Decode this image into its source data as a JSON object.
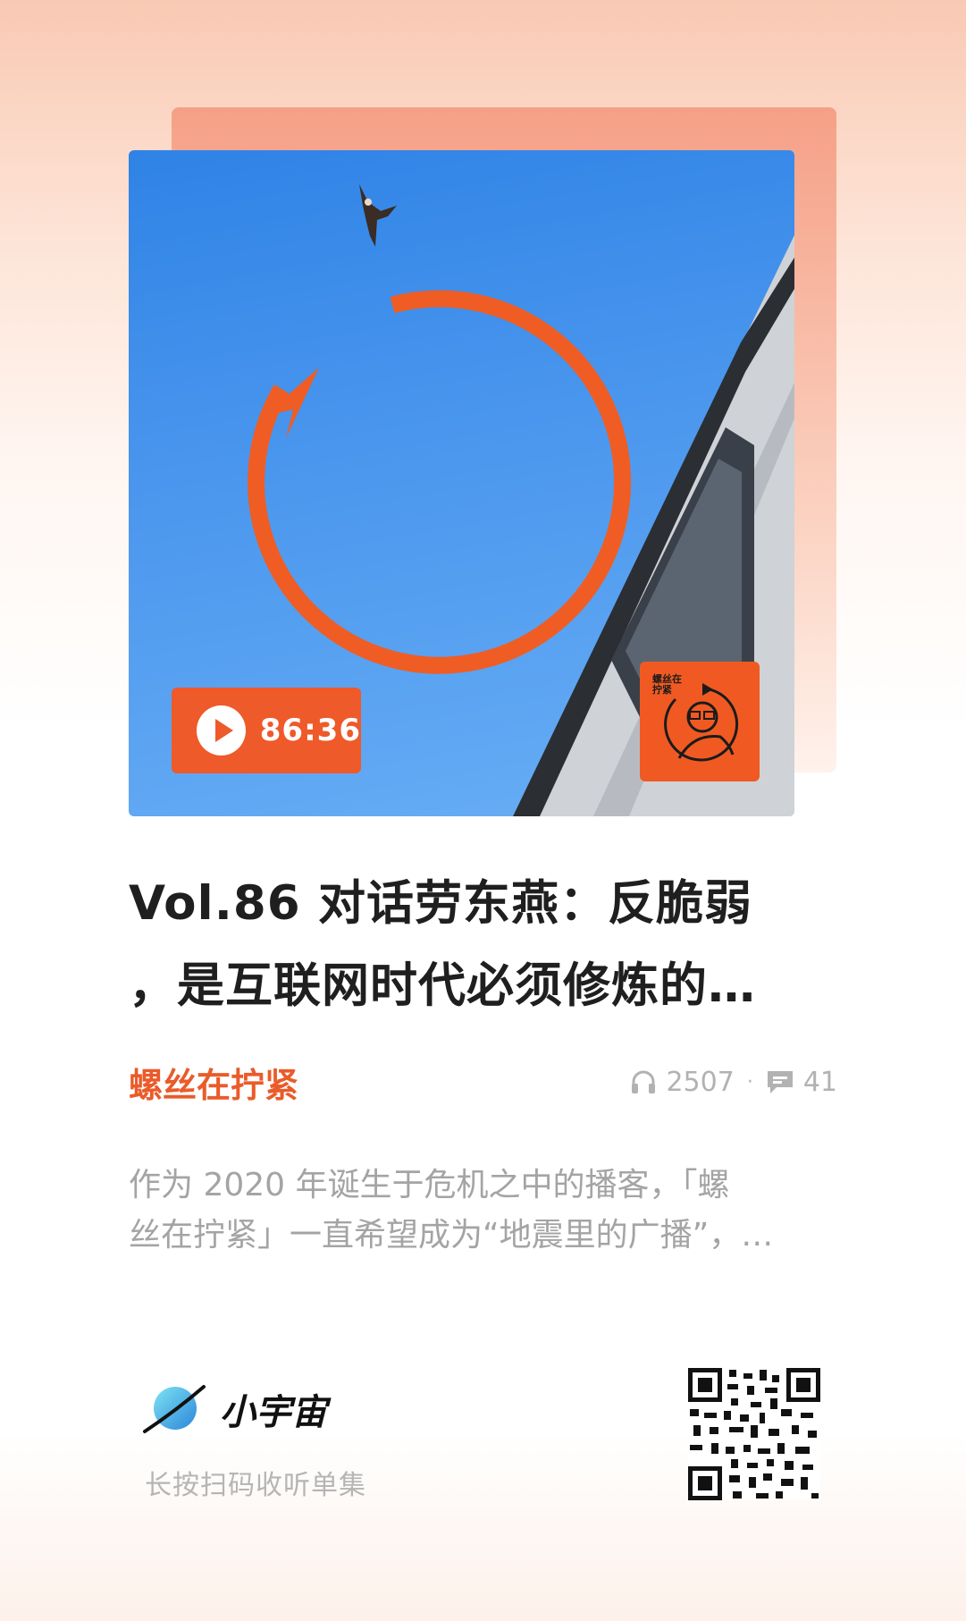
{
  "episode": {
    "duration": "86:36",
    "title_lines": [
      "Vol.86 对话劳东燕：反脆弱",
      "，是互联网时代必须修炼的…"
    ]
  },
  "cover": {
    "logo_badge_text": "螺丝在拧紧"
  },
  "podcast": {
    "name": "螺丝在拧紧"
  },
  "stats": {
    "plays": "2507",
    "separator": "·",
    "comments": "41"
  },
  "description": {
    "lines": [
      "作为 2020 年诞生于危机之中的播客，「螺",
      "丝在拧紧」一直希望成为“地震里的广播”，…"
    ]
  },
  "footer": {
    "brand_name": "小宇宙",
    "hint": "长按扫码收听单集"
  },
  "colors": {
    "accent": "#ea5b2a",
    "title": "#1f1f1f",
    "muted": "#a4a4a4"
  }
}
